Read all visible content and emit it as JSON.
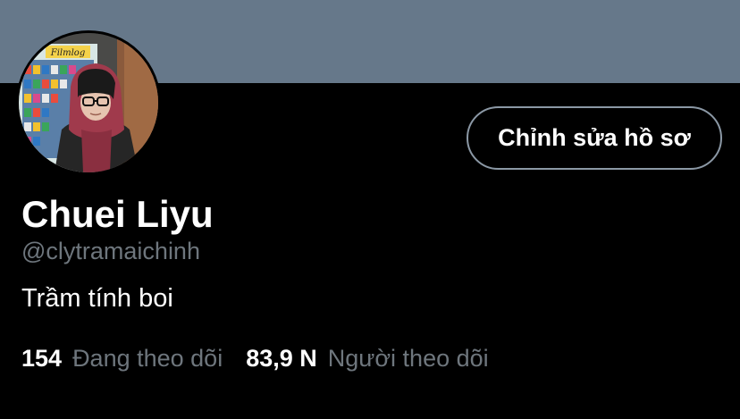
{
  "profile": {
    "display_name": "Chuei Liyu",
    "handle": "@clytramaichinh",
    "bio": "Trầm tính boi",
    "edit_button_label": "Chỉnh sửa hồ sơ",
    "avatar_sign_text": "Filmlog"
  },
  "stats": {
    "following_count": "154",
    "following_label": "Đang theo dõi",
    "followers_count": "83,9 N",
    "followers_label": "Người theo dõi"
  },
  "colors": {
    "banner": "#66788a",
    "background": "#000000",
    "primary_text": "#ffffff",
    "secondary_text": "#6e767d",
    "button_border": "#8b98a5"
  }
}
